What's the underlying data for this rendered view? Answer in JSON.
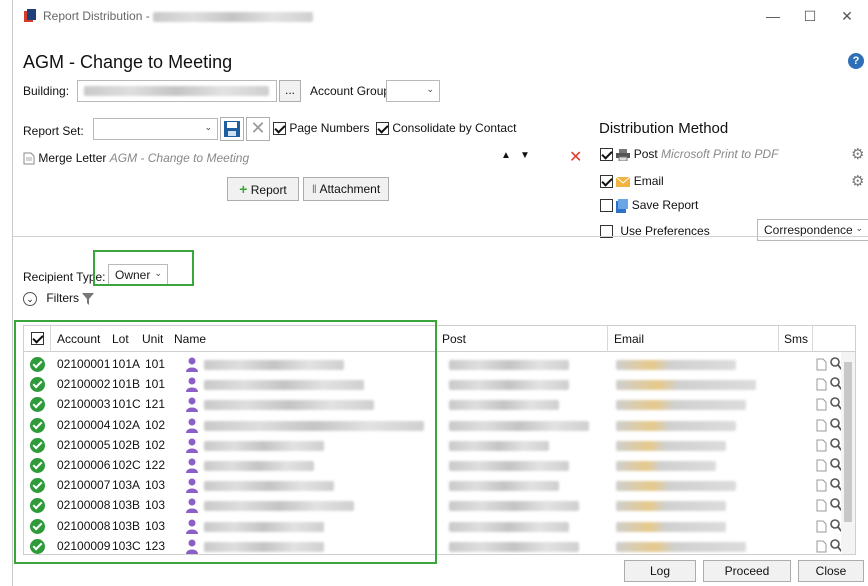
{
  "window": {
    "title_prefix": "Report Distribution -",
    "minimize": "—",
    "maximize": "☐",
    "close": "✕"
  },
  "header": {
    "title": "AGM - Change to Meeting",
    "help": "?"
  },
  "building": {
    "label": "Building:",
    "browse": "...",
    "account_group_label": "Account Group:"
  },
  "report_set": {
    "label": "Report Set:",
    "page_numbers": "Page Numbers",
    "consolidate": "Consolidate by Contact"
  },
  "merge": {
    "type": "Merge Letter",
    "name": "AGM - Change to Meeting"
  },
  "buttons": {
    "report": "Report",
    "attachment": "Attachment"
  },
  "distribution": {
    "title": "Distribution Method",
    "post_label": "Post",
    "post_printer": "Microsoft Print to PDF",
    "email_label": "Email",
    "save_report_label": "Save Report",
    "use_prefs_label": "Use Preferences",
    "prefs_select": "Correspondence"
  },
  "recipient": {
    "label": "Recipient Type:",
    "value": "Owner",
    "filters": "Filters"
  },
  "grid": {
    "headers": {
      "account": "Account",
      "lot": "Lot",
      "unit": "Unit",
      "name": "Name",
      "post": "Post",
      "email": "Email",
      "sms": "Sms"
    },
    "rows": [
      {
        "account": "02100001",
        "lot": "101A",
        "unit": "101"
      },
      {
        "account": "02100002",
        "lot": "101B",
        "unit": "101"
      },
      {
        "account": "02100003",
        "lot": "101C",
        "unit": "121"
      },
      {
        "account": "02100004",
        "lot": "102A",
        "unit": "102"
      },
      {
        "account": "02100005",
        "lot": "102B",
        "unit": "102"
      },
      {
        "account": "02100006",
        "lot": "102C",
        "unit": "122"
      },
      {
        "account": "02100007",
        "lot": "103A",
        "unit": "103"
      },
      {
        "account": "02100008",
        "lot": "103B",
        "unit": "103"
      },
      {
        "account": "02100008",
        "lot": "103B",
        "unit": "103"
      },
      {
        "account": "02100009",
        "lot": "103C",
        "unit": "123"
      }
    ]
  },
  "footer": {
    "log": "Log",
    "proceed": "Proceed",
    "close": "Close"
  },
  "colors": {
    "accent_green": "#3aa53a",
    "status_green": "#2e9a3a",
    "person_purple": "#8b5fc6",
    "help_blue": "#2f6fb7"
  }
}
